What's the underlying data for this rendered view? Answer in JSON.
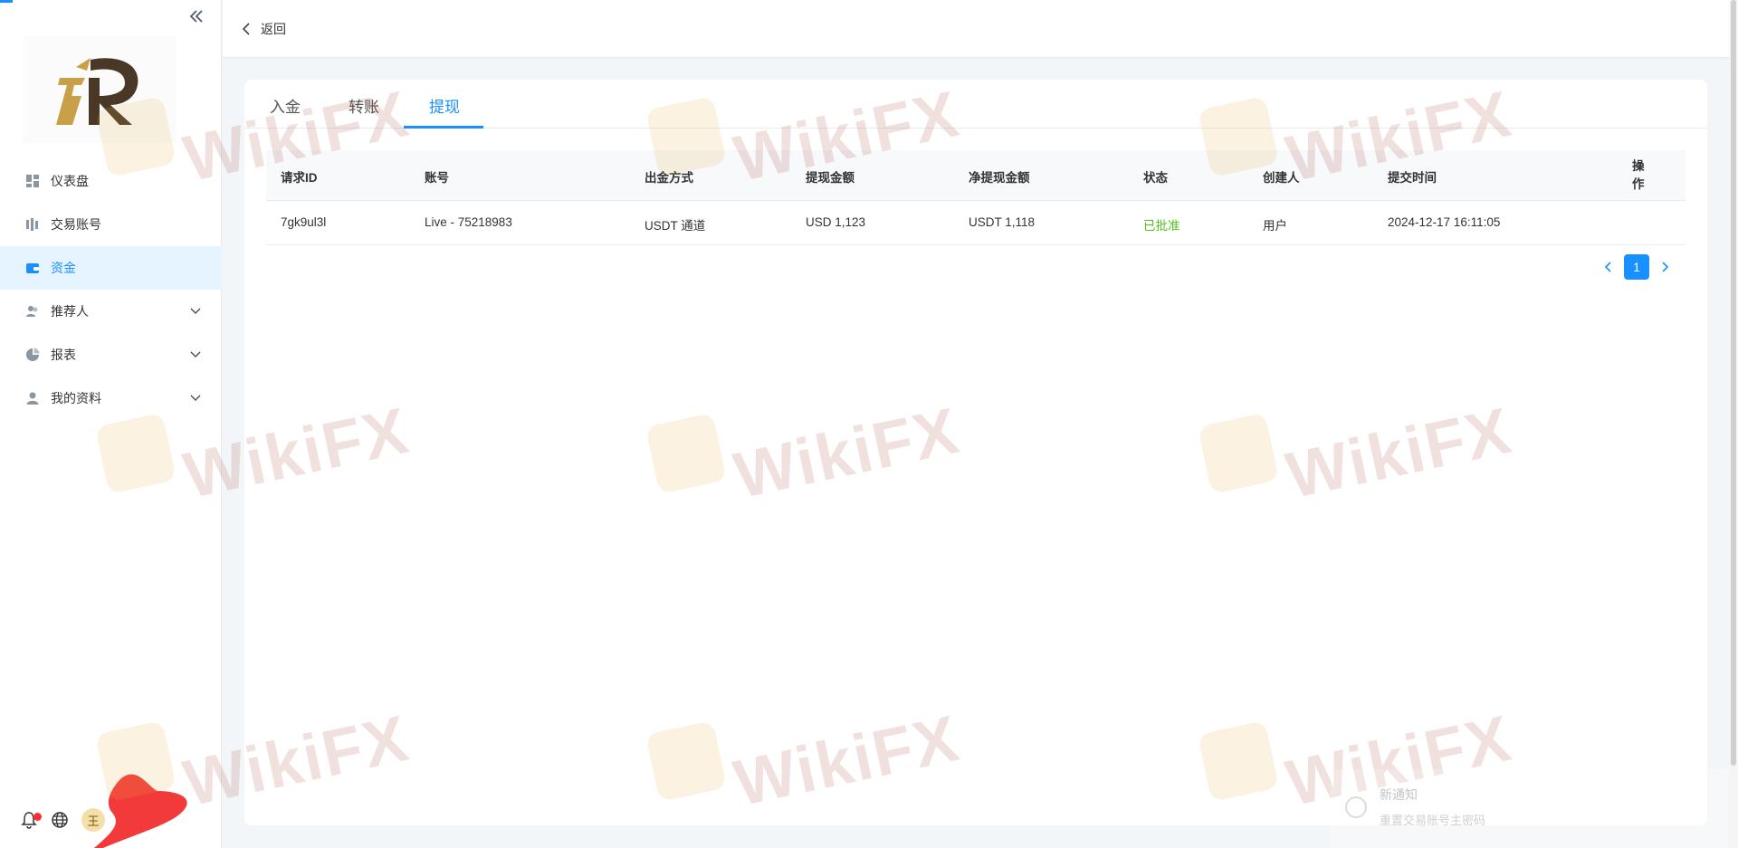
{
  "header": {
    "back_label": "返回"
  },
  "sidebar": {
    "items": [
      {
        "label": "仪表盘",
        "icon": "dashboard-icon",
        "active": false,
        "expandable": false
      },
      {
        "label": "交易账号",
        "icon": "trading-accounts-icon",
        "active": false,
        "expandable": false
      },
      {
        "label": "资金",
        "icon": "wallet-icon",
        "active": true,
        "expandable": false
      },
      {
        "label": "推荐人",
        "icon": "referrer-icon",
        "active": false,
        "expandable": true
      },
      {
        "label": "报表",
        "icon": "pie-chart-icon",
        "active": false,
        "expandable": true
      },
      {
        "label": "我的资料",
        "icon": "user-profile-icon",
        "active": false,
        "expandable": true
      }
    ],
    "footer": {
      "avatar_text": "王"
    }
  },
  "tabs": [
    {
      "label": "入金",
      "active": false
    },
    {
      "label": "转账",
      "active": false
    },
    {
      "label": "提现",
      "active": true
    }
  ],
  "table": {
    "headers": [
      "请求ID",
      "账号",
      "出金方式",
      "提现金额",
      "净提现金额",
      "状态",
      "创建人",
      "提交时间",
      "操作"
    ],
    "rows": [
      {
        "request_id": "7gk9ul3l",
        "account": "Live - 75218983",
        "method": "USDT 通道",
        "amount": "USD 1,123",
        "net_amount": "USDT 1,118",
        "status": "已批准",
        "creator": "用户",
        "submitted_at": "2024-12-17 16:11:05"
      }
    ]
  },
  "pagination": {
    "current_page": "1"
  },
  "watermark": {
    "text": "WikiFX"
  },
  "notification": {
    "title": "新通知",
    "body": "重置交易账号主密码"
  },
  "colors": {
    "accent": "#1890ff",
    "success": "#52c41a",
    "alert_dot": "#ff2e2e"
  }
}
